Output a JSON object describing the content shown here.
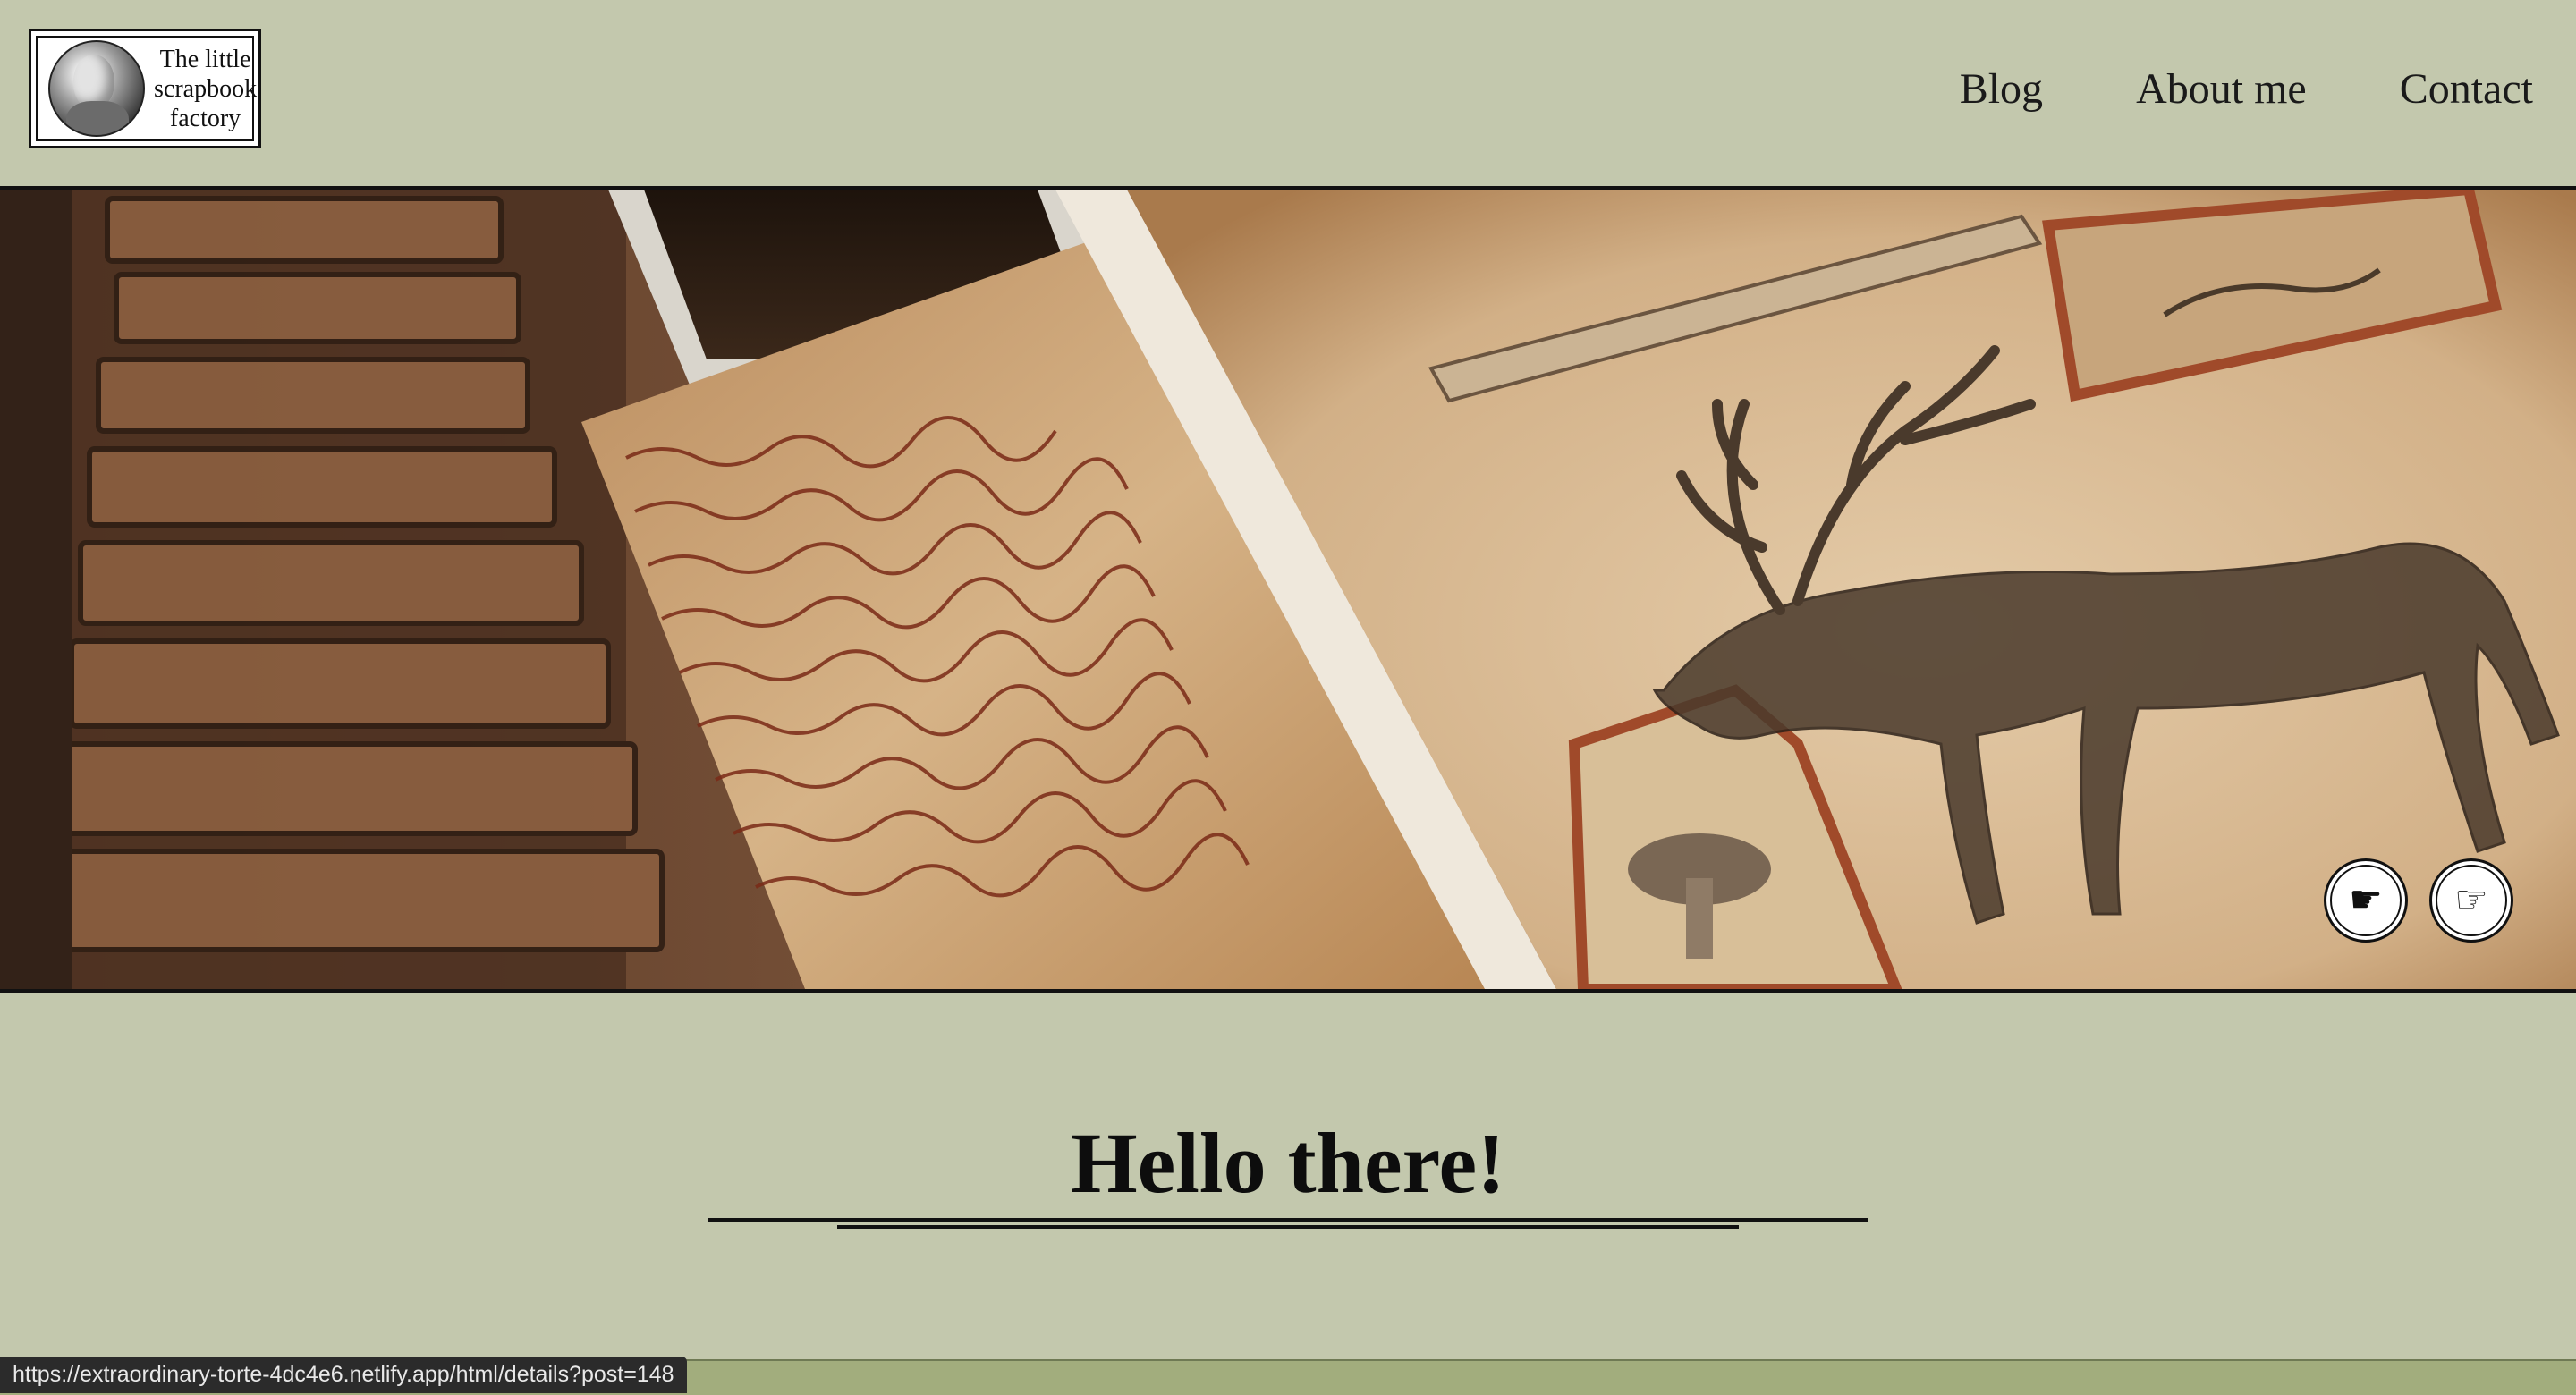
{
  "header": {
    "logo_text": "The little scrapbook factory",
    "logo_line1": "The little",
    "logo_line2": "scrapbook",
    "logo_line3": "factory",
    "nav": [
      "Blog",
      "About me",
      "Contact"
    ]
  },
  "hero": {
    "controls": {
      "prev_icon": "pointing-hand-left-icon",
      "next_icon": "pointing-hand-right-icon"
    }
  },
  "main": {
    "heading": "Hello there!"
  },
  "statusbar": {
    "url": "https://extraordinary-torte-4dc4e6.netlify.app/html/details?post=148"
  },
  "colors": {
    "page_background": "#c3c8ad",
    "footer": "#a2ad7d",
    "ink": "#111111"
  }
}
